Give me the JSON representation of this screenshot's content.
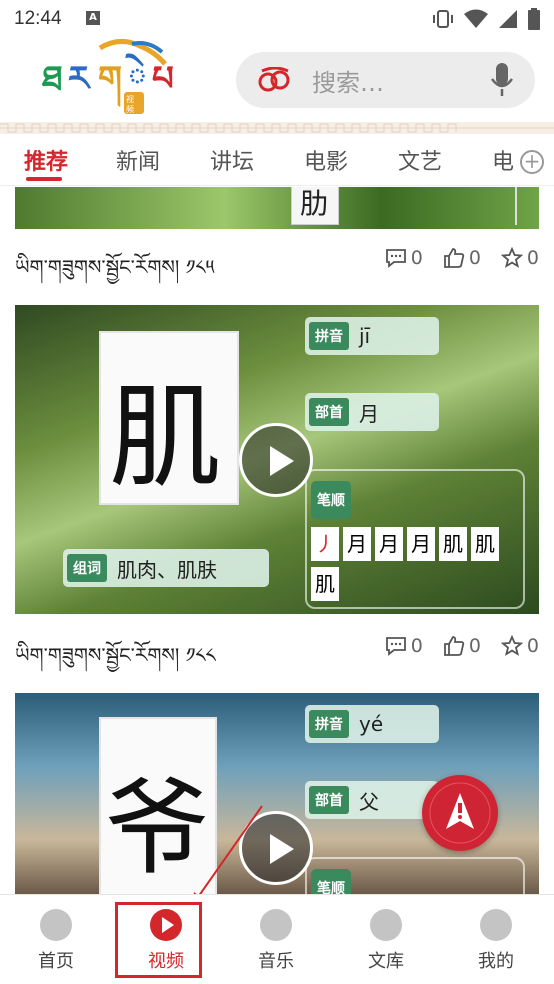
{
  "status_bar": {
    "time": "12:44",
    "notification_letter": "A"
  },
  "header": {
    "search_placeholder": "搜索…"
  },
  "tabs": [
    {
      "label": "推荐",
      "active": true
    },
    {
      "label": "新闻"
    },
    {
      "label": "讲坛"
    },
    {
      "label": "电影"
    },
    {
      "label": "文艺"
    },
    {
      "label": "电"
    }
  ],
  "feed": {
    "items": [
      {
        "caption": "ཡིག་གཟུགས་སྦྱོང་རོགས། ༡༨༥",
        "thumb_char": "肋",
        "comments": "0",
        "likes": "0",
        "favorites": "0"
      },
      {
        "caption": "ཡིག་གཟུགས་སྦྱོང་རོགས། ༡༨༨",
        "big_char": "肌",
        "pinyin_key": "拼音",
        "pinyin_val": "jī",
        "radical_key": "部首",
        "radical_val": "月",
        "strokes_key": "笔顺",
        "strokes": [
          "丿",
          "月",
          "月",
          "月",
          "肌",
          "肌",
          "肌"
        ],
        "words_key": "组词",
        "words_val": "肌肉、肌肤",
        "comments": "0",
        "likes": "0",
        "favorites": "0"
      },
      {
        "big_char": "爷",
        "pinyin_key": "拼音",
        "pinyin_val": "yé",
        "radical_key": "部首",
        "radical_val": "父",
        "strokes_key": "笔顺"
      }
    ]
  },
  "bottom_nav": [
    {
      "label": "首页"
    },
    {
      "label": "视频",
      "active": true
    },
    {
      "label": "音乐"
    },
    {
      "label": "文库"
    },
    {
      "label": "我的"
    }
  ],
  "colors": {
    "accent": "#d4272c",
    "tag_green": "#3a8a5e"
  },
  "icons": [
    "signal-icon",
    "wifi-icon",
    "battery-icon",
    "vibrate-icon",
    "search-logo-icon",
    "mic-icon",
    "comment-icon",
    "like-icon",
    "favorite-icon",
    "alert-fab-icon",
    "add-tab-icon"
  ]
}
